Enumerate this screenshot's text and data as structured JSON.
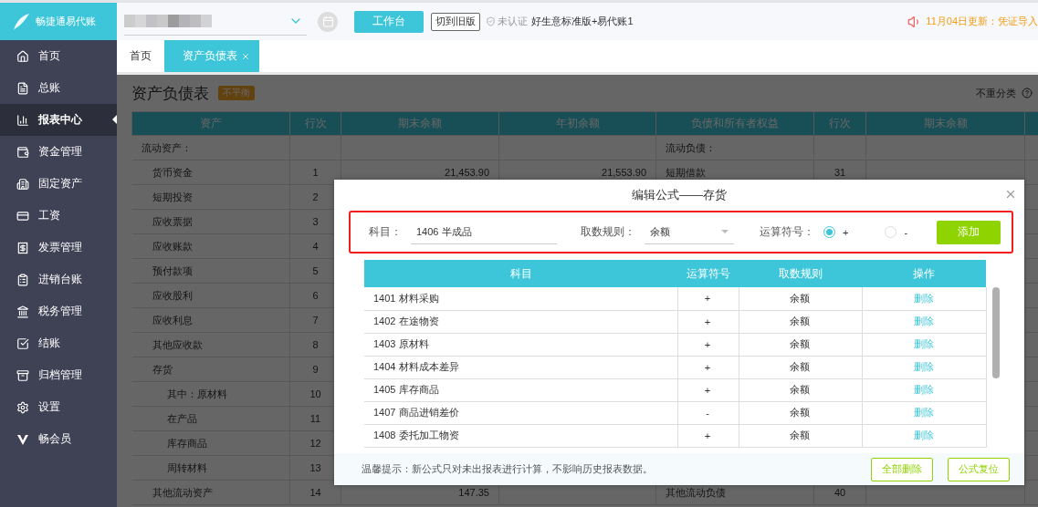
{
  "brand": {
    "name": "畅捷通易代账"
  },
  "topbar": {
    "workbench_button": "工作台",
    "old_version_button": "切到旧版",
    "cert_status": "未认证",
    "edition": "好生意标准版+易代账1",
    "notice": "11月04日更新：凭证导入"
  },
  "sidebar": {
    "items": [
      {
        "label": "首页",
        "selected": false
      },
      {
        "label": "总账",
        "selected": false
      },
      {
        "label": "报表中心",
        "selected": true
      },
      {
        "label": "资金管理",
        "selected": false
      },
      {
        "label": "固定资产",
        "selected": false
      },
      {
        "label": "工资",
        "selected": false
      },
      {
        "label": "发票管理",
        "selected": false
      },
      {
        "label": "进销台账",
        "selected": false
      },
      {
        "label": "税务管理",
        "selected": false
      },
      {
        "label": "结账",
        "selected": false
      },
      {
        "label": "归档管理",
        "selected": false
      },
      {
        "label": "设置",
        "selected": false
      },
      {
        "label": "畅会员",
        "selected": false
      }
    ]
  },
  "tabs": [
    {
      "label": "首页",
      "selected": false,
      "closable": false
    },
    {
      "label": "资产负债表",
      "selected": true,
      "closable": true
    }
  ],
  "page": {
    "title": "资产负债表",
    "badge": "不平衡",
    "reclassify_label": "不重分类"
  },
  "balance_sheet": {
    "columns": [
      "资产",
      "行次",
      "期末余额",
      "年初余额",
      "负债和所有者权益",
      "行次",
      "期末余额"
    ],
    "rows": [
      {
        "kind": "section",
        "asset": "流动资产：",
        "liability": "流动负债："
      },
      {
        "kind": "item",
        "asset": "货币资金",
        "asset_line": "1",
        "asset_end": "21,453.90",
        "asset_start": "21,553.90",
        "liability": "短期借款",
        "liability_line": "31"
      },
      {
        "kind": "item",
        "asset": "短期投资",
        "asset_line": "2"
      },
      {
        "kind": "item",
        "asset": "应收票据",
        "asset_line": "3"
      },
      {
        "kind": "item",
        "asset": "应收账款",
        "asset_line": "4"
      },
      {
        "kind": "item",
        "asset": "预付款项",
        "asset_line": "5"
      },
      {
        "kind": "item",
        "asset": "应收股利",
        "asset_line": "6"
      },
      {
        "kind": "item",
        "asset": "应收利息",
        "asset_line": "7"
      },
      {
        "kind": "item",
        "asset": "其他应收款",
        "asset_line": "8"
      },
      {
        "kind": "item",
        "asset": "存货",
        "asset_line": "9"
      },
      {
        "kind": "sub",
        "asset": "其中：原材料",
        "asset_line": "10"
      },
      {
        "kind": "sub",
        "asset": "在产品",
        "asset_line": "11"
      },
      {
        "kind": "sub",
        "asset": "库存商品",
        "asset_line": "12"
      },
      {
        "kind": "sub",
        "asset": "周转材料",
        "asset_line": "13"
      },
      {
        "kind": "item",
        "asset": "其他流动资产",
        "asset_line": "14",
        "asset_end": "147.35",
        "liability": "其他流动负债",
        "liability_line": "40"
      }
    ]
  },
  "modal": {
    "title": "编辑公式——存货",
    "form": {
      "subject_label": "科目：",
      "subject_value": "1406 半成品",
      "rule_label": "取数规则：",
      "rule_value": "余额",
      "operator_label": "运算符号：",
      "operators": [
        {
          "label": "+",
          "selected": true
        },
        {
          "label": "-",
          "selected": false
        }
      ],
      "add_button": "添加"
    },
    "table": {
      "columns": [
        "科目",
        "运算符号",
        "取数规则",
        "操作"
      ],
      "rows": [
        {
          "subject": "1401 材料采购",
          "operator": "+",
          "rule": "余额",
          "action": "删除"
        },
        {
          "subject": "1402 在途物资",
          "operator": "+",
          "rule": "余额",
          "action": "删除"
        },
        {
          "subject": "1403 原材料",
          "operator": "+",
          "rule": "余额",
          "action": "删除"
        },
        {
          "subject": "1404 材料成本差异",
          "operator": "+",
          "rule": "余额",
          "action": "删除"
        },
        {
          "subject": "1405 库存商品",
          "operator": "+",
          "rule": "余额",
          "action": "删除"
        },
        {
          "subject": "1407 商品进销差价",
          "operator": "-",
          "rule": "余额",
          "action": "删除"
        },
        {
          "subject": "1408 委托加工物资",
          "operator": "+",
          "rule": "余额",
          "action": "删除"
        }
      ]
    },
    "hint": "温馨提示：新公式只对未出报表进行计算，不影响历史报表数据。",
    "buttons": [
      "全部删除",
      "公式复位"
    ]
  }
}
